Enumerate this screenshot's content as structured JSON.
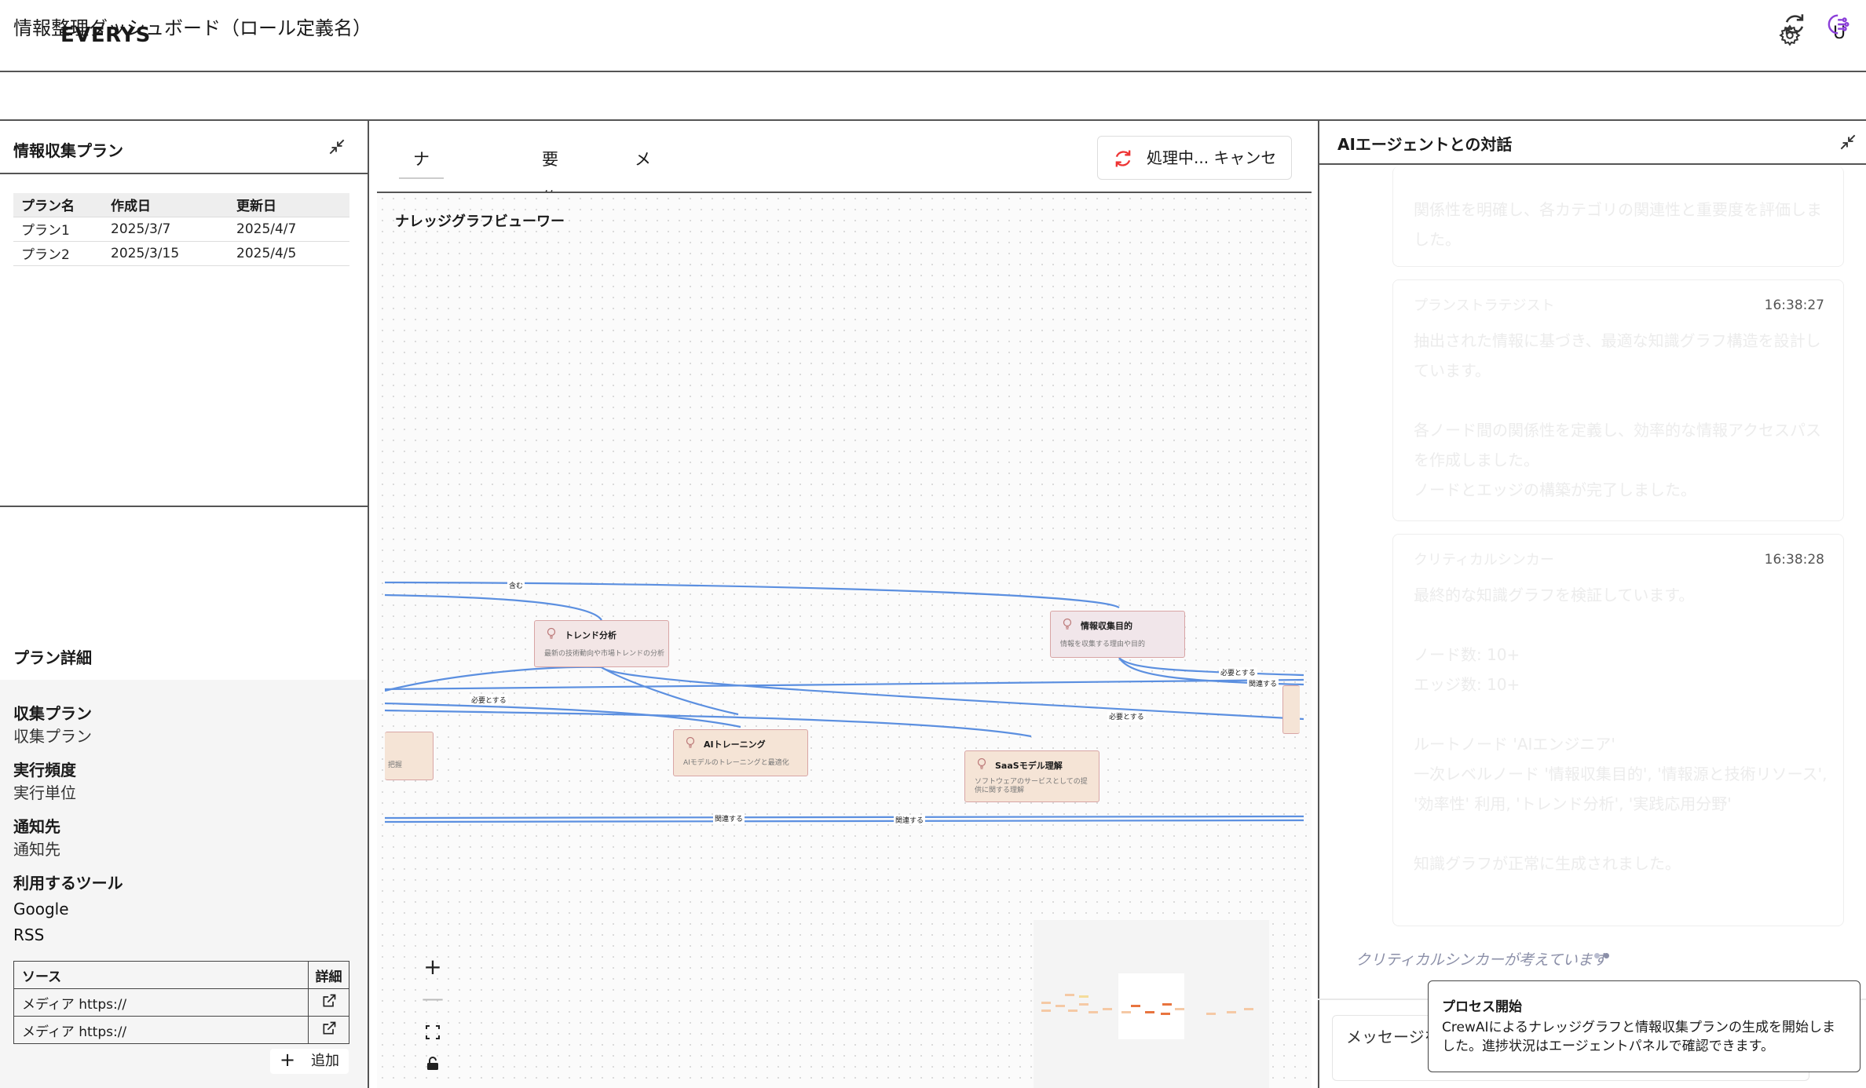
{
  "header": {
    "logo": "EVERYS",
    "user_initial": "U",
    "icons": [
      "gear-icon"
    ]
  },
  "titlebar": {
    "title": "情報整理ダッシュボード（ロール定義名）",
    "icons": [
      "refresh-icon",
      "ai-agent-icon"
    ]
  },
  "plans_panel": {
    "title": "情報収集プラン",
    "columns": [
      "プラン名",
      "作成日",
      "更新日"
    ],
    "rows": [
      [
        "プラン1",
        "2025/3/7",
        "2025/4/7"
      ],
      [
        "プラン2",
        "2025/3/15",
        "2025/4/5"
      ]
    ]
  },
  "plan_detail": {
    "title": "プラン詳細",
    "fields": [
      {
        "label": "収集プラン",
        "value": "収集プラン"
      },
      {
        "label": "実行頻度",
        "value": "実行単位"
      },
      {
        "label": "通知先",
        "value": "通知先"
      }
    ],
    "tools_label": "利用するツール",
    "tools": [
      "Google",
      "RSS"
    ],
    "sources_columns": [
      "ソース",
      "詳細"
    ],
    "sources": [
      "メディア https://",
      "メディア https://"
    ],
    "add_label": "追加"
  },
  "center": {
    "tabs": [
      "ナレッジグラフ",
      "要約結果",
      "メモ"
    ],
    "processing_label": "処理中... キャンセル",
    "viewer_title": "ナレッジグラフビューワー",
    "nodes": [
      {
        "title": "トレンド分析",
        "desc": "最新の技術動向や市場トレンドの分析"
      },
      {
        "title": "情報収集目的",
        "desc": "情報を収集する理由や目的"
      },
      {
        "title": "AIトレーニング",
        "desc": "AIモデルのトレーニングと最適化"
      },
      {
        "title": "SaaSモデル理解",
        "desc": "ソフトウェアのサービスとしての提供に関する理解"
      },
      {
        "title": "",
        "desc": "把握"
      }
    ],
    "edge_labels": [
      "含む",
      "必要とする",
      "必要とする",
      "必要とする",
      "関連する",
      "関連する",
      "関連する"
    ],
    "zoom_controls": [
      "+",
      "—"
    ]
  },
  "chat": {
    "title": "AIエージェントとの対話",
    "messages": [
      {
        "author": "",
        "time": "",
        "text": "関係性を明確し、各カテゴリの関連性と重要度を評価しました。"
      },
      {
        "author": "プランストラテジスト",
        "time": "16:38:27",
        "text": "抽出された情報に基づき、最適な知識グラフ構造を設計しています。\n\n各ノード間の関係性を定義し、効率的な情報アクセスパスを作成しました。\nノードとエッジの構築が完了しました。"
      },
      {
        "author": "クリティカルシンカー",
        "time": "16:38:28",
        "text": "最終的な知識グラフを検証しています。\n\nノード数: 10+\nエッジ数: 10+\n\nルートノード 'AIエンジニア'\n一次レベルノード '情報収集目的', '情報源と技術リソース', '効率性' 利用, 'トレンド分析', '実践応用分野'\n\n知識グラフが正常に生成されました。"
      }
    ],
    "thinking": "クリティカルシンカーが考えています",
    "input_placeholder": "メッセージを入力",
    "toast": {
      "title": "プロセス開始",
      "body": "CrewAIによるナレッジグラフと情報収集プランの生成を開始しました。進捗状況はエージェントパネルで確認できます。"
    }
  }
}
